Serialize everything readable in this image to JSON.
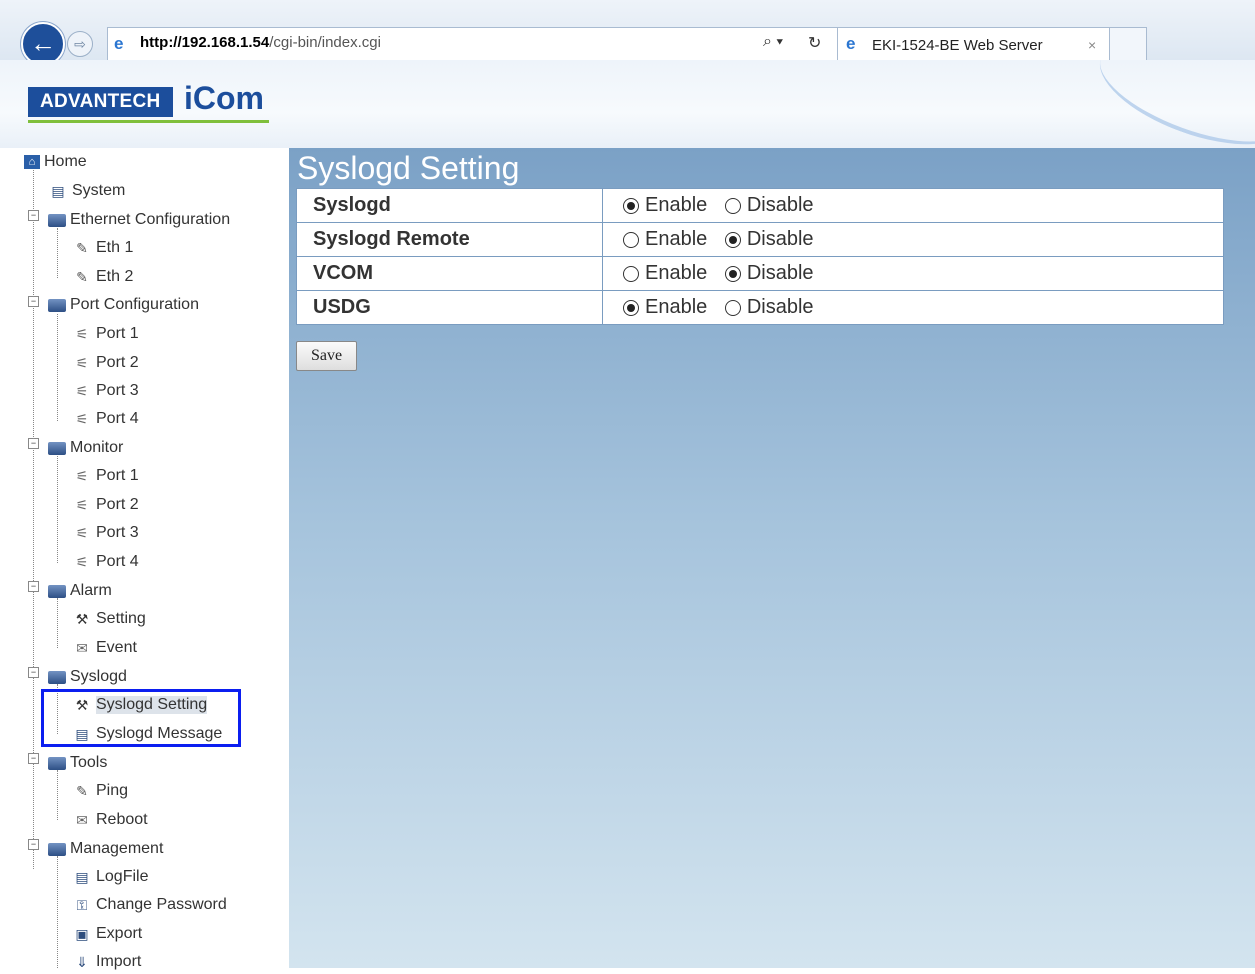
{
  "browser": {
    "url_host": "http://192.168.1.54",
    "url_path": "/cgi-bin/index.cgi",
    "search_icon": "⌕ ▾",
    "refresh_icon": "↻",
    "tab_title": "EKI-1524-BE Web Server",
    "tab_close": "×"
  },
  "header": {
    "brand": "ADVANTECH",
    "product": "iCom"
  },
  "sidebar": {
    "home": "Home",
    "system": "System",
    "ethernet": "Ethernet Configuration",
    "eth1": "Eth 1",
    "eth2": "Eth 2",
    "port_config": "Port Configuration",
    "pc_port1": "Port 1",
    "pc_port2": "Port 2",
    "pc_port3": "Port 3",
    "pc_port4": "Port 4",
    "monitor": "Monitor",
    "mon_port1": "Port 1",
    "mon_port2": "Port 2",
    "mon_port3": "Port 3",
    "mon_port4": "Port 4",
    "alarm": "Alarm",
    "alarm_setting": "Setting",
    "alarm_event": "Event",
    "syslogd": "Syslogd",
    "syslogd_setting": "Syslogd Setting",
    "syslogd_message": "Syslogd Message",
    "tools": "Tools",
    "ping": "Ping",
    "reboot": "Reboot",
    "management": "Management",
    "logfile": "LogFile",
    "change_password": "Change Password",
    "export": "Export",
    "import": "Import"
  },
  "main": {
    "title": "Syslogd Setting",
    "enable_label": "Enable",
    "disable_label": "Disable",
    "rows": [
      {
        "label": "Syslogd",
        "enabled": true
      },
      {
        "label": "Syslogd Remote",
        "enabled": false
      },
      {
        "label": "VCOM",
        "enabled": false
      },
      {
        "label": "USDG",
        "enabled": true
      }
    ],
    "save_label": "Save"
  }
}
